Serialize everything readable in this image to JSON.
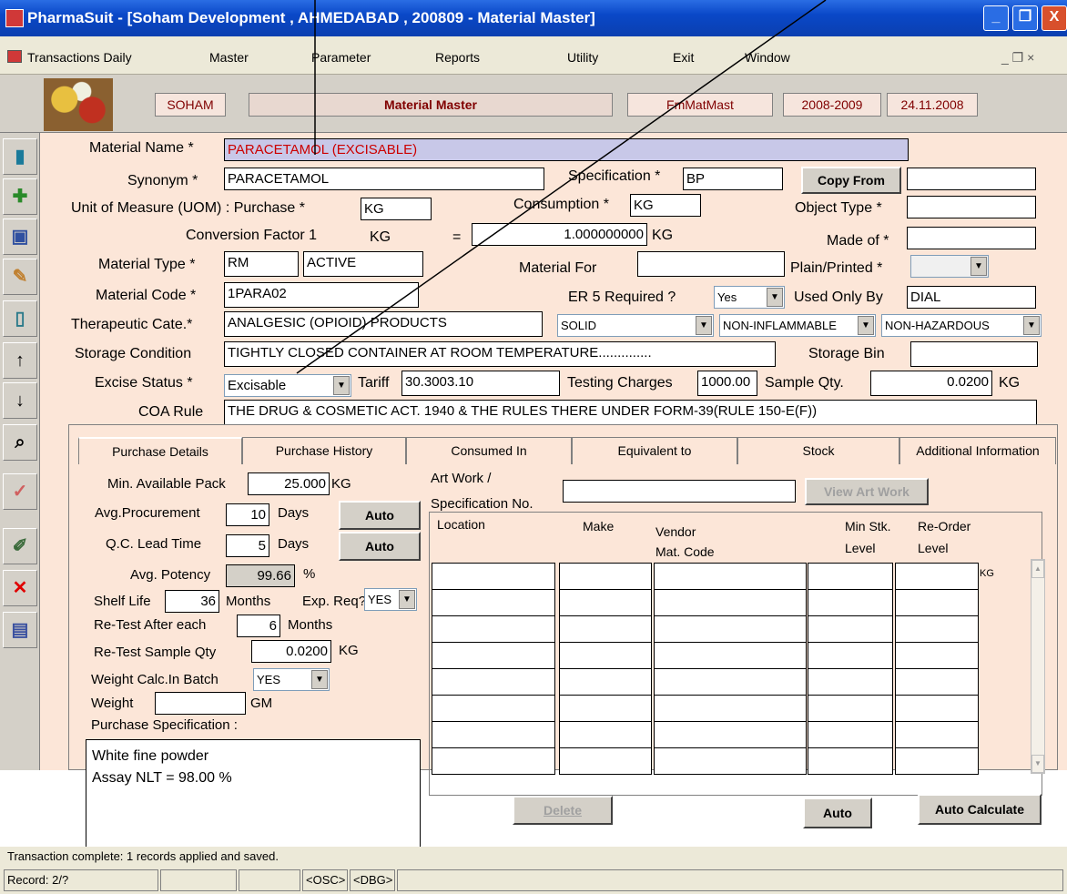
{
  "window": {
    "title": "PharmaSuit - [Soham Development , AHMEDABAD , 200809 - Material Master]",
    "minimize": "_",
    "restore": "❐",
    "close": "X"
  },
  "menubar": {
    "items": [
      "Transactions Daily",
      "Master",
      "Parameter",
      "Reports",
      "Utility",
      "Exit",
      "Window"
    ],
    "mdi_controls": "_ ❐ ×"
  },
  "header": {
    "company": "SOHAM",
    "form_title": "Material Master",
    "form_code": "FmMatMast",
    "year": "2008-2009",
    "date": "24.11.2008"
  },
  "form": {
    "material_name_label": "Material Name *",
    "material_name": "PARACETAMOL (EXCISABLE)",
    "synonym_label": "Synonym *",
    "synonym": "PARACETAMOL",
    "specification_label": "Specification *",
    "specification": "BP",
    "copy_from": "Copy From",
    "uom_purchase_label": "Unit of Measure (UOM) : Purchase *",
    "uom_purchase": "KG",
    "consumption_label": "Consumption *",
    "consumption": "KG",
    "object_type_label": "Object Type *",
    "conversion_label": "Conversion Factor 1",
    "conversion_unit1": "KG",
    "equals": "=",
    "conversion_value": "1.000000000",
    "conversion_unit2": "KG",
    "made_of_label": "Made of *",
    "material_type_label": "Material Type *",
    "material_type": "RM",
    "material_subtype": "ACTIVE",
    "material_for_label": "Material For",
    "plain_printed_label": "Plain/Printed *",
    "material_code_label": "Material Code *",
    "material_code": "1PARA02",
    "er5_label": "ER 5 Required ?",
    "er5_value": "Yes",
    "used_only_by_label": "Used Only By",
    "used_only_by": "DIAL",
    "therapeutic_label": "Therapeutic Cate.*",
    "therapeutic": "ANALGESIC (OPIOID) PRODUCTS",
    "form_type": "SOLID",
    "flammable": "NON-INFLAMMABLE",
    "hazardous": "NON-HAZARDOUS",
    "storage_condition_label": "Storage Condition",
    "storage_condition": "TIGHTLY CLOSED CONTAINER AT ROOM TEMPERATURE..............",
    "storage_bin_label": "Storage Bin",
    "excise_status_label": "Excise Status *",
    "excise_status": "Excisable",
    "tariff_label": "Tariff",
    "tariff": "30.3003.10",
    "testing_charges_label": "Testing Charges",
    "testing_charges": "1000.00",
    "sample_qty_label": "Sample Qty.",
    "sample_qty": "0.0200",
    "sample_unit": "KG",
    "coa_rule_label": "COA Rule",
    "coa_rule": "THE DRUG & COSMETIC ACT. 1940 & THE RULES THERE UNDER FORM-39(RULE 150-E(F))"
  },
  "tabs": [
    "Purchase Details",
    "Purchase History",
    "Consumed In",
    "Equivalent to",
    "Stock",
    "Additional Information"
  ],
  "purchase": {
    "min_pack_label": "Min. Available Pack",
    "min_pack": "25.000",
    "min_pack_unit": "KG",
    "avg_proc_label": "Avg.Procurement",
    "avg_proc": "10",
    "days": "Days",
    "auto": "Auto",
    "qc_lead_label": "Q.C. Lead Time",
    "qc_lead": "5",
    "avg_potency_label": "Avg. Potency",
    "avg_potency": "99.66",
    "percent": "%",
    "shelf_life_label": "Shelf Life",
    "shelf_life": "36",
    "months": "Months",
    "exp_req_label": "Exp. Req?",
    "exp_req": "YES",
    "retest_label": "Re-Test After each",
    "retest": "6",
    "retest_qty_label": "Re-Test Sample Qty",
    "retest_qty": "0.0200",
    "retest_unit": "KG",
    "weight_calc_label": "Weight Calc.In Batch",
    "weight_calc": "YES",
    "weight_label": "Weight",
    "weight_unit": "GM",
    "purchase_spec_label": "Purchase Specification :",
    "purchase_spec_line1": "White fine powder",
    "purchase_spec_line2": "Assay NLT = 98.00 %",
    "artwork_label1": "Art Work /",
    "artwork_label2": "Specification No.",
    "view_artwork": "View Art Work",
    "col_location": "Location",
    "col_make": "Make",
    "col_vendor1": "Vendor",
    "col_vendor2": "Mat. Code",
    "col_min1": "Min Stk.",
    "col_min2": "Level",
    "col_reorder1": "Re-Order",
    "col_reorder2": "Level",
    "grid_unit": "KG",
    "delete": "Delete",
    "auto2": "Auto",
    "auto_calc": "Auto Calculate"
  },
  "status": {
    "message": "Transaction complete: 1 records applied and saved.",
    "record": "Record: 2/?",
    "osc": "<OSC>",
    "dbg": "<DBG>"
  }
}
